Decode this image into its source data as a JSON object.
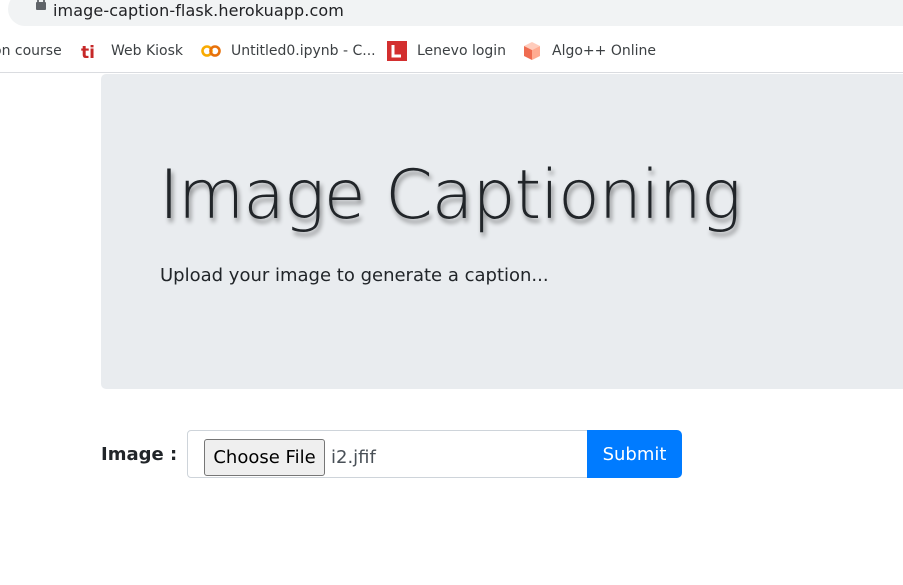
{
  "browser": {
    "url": "image-caption-flask.herokuapp.com",
    "bookmarks": [
      {
        "label": "on course",
        "icon": "none"
      },
      {
        "label": "Web Kiosk",
        "icon": "ti-logo-icon"
      },
      {
        "label": "Untitled0.ipynb - C...",
        "icon": "colab-icon"
      },
      {
        "label": "Lenevo login",
        "icon": "l-logo-icon"
      },
      {
        "label": "Algo++ Online",
        "icon": "cube-icon"
      }
    ]
  },
  "hero": {
    "title": "Image Captioning",
    "subtitle": "Upload your image to generate a caption..."
  },
  "form": {
    "label": "Image :",
    "choose_label": "Choose File",
    "file_name": "i2.jfif",
    "submit_label": "Submit"
  },
  "colors": {
    "jumbotron_bg": "#e9ecef",
    "submit_bg": "#007bff",
    "text": "#212529"
  }
}
